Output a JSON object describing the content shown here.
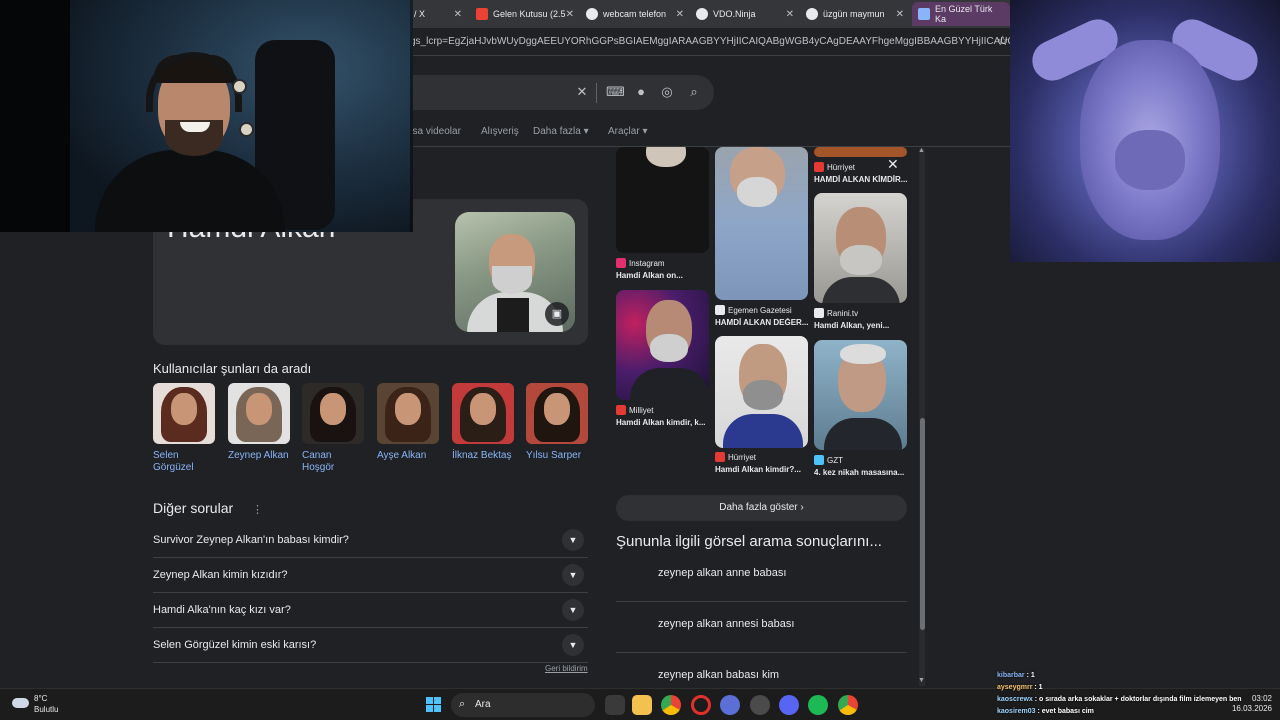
{
  "browser": {
    "tabs": [
      {
        "title": "/ X",
        "icon_color": "#000000"
      },
      {
        "title": "Gelen Kutusu (2.5",
        "icon_color": "#ea4335"
      },
      {
        "title": "webcam telefon",
        "icon_color": "#e8eaed"
      },
      {
        "title": "VDO.Ninja",
        "icon_color": "#e8eaed"
      },
      {
        "title": "üzgün maymun",
        "icon_color": "#e8eaed"
      },
      {
        "title": "En Güzel Türk Ka",
        "icon_color": "#8ab4f8"
      }
    ],
    "address": "gs_lcrp=EgZjaHJvbWUyDggAEEUYORhGGPsBGIAEMggIARAAGBYYHjIICAIQABgWGB4yCAgDEAAYFhgeMggIBBAAGBYYHjIICAUQABgWGB4...",
    "star_icon": "star-icon"
  },
  "search": {
    "query": "",
    "filters": [
      "usa videolar",
      "Alışveriş",
      "Daha fazla",
      "Araçlar"
    ]
  },
  "knowledge_panel": {
    "title": "Hamdi Alkan"
  },
  "people_also_search": {
    "title": "Kullanıcılar şunları da aradı",
    "people": [
      {
        "name": "Selen Görgüzel",
        "hair": "#5a2b1e",
        "bg": "#e6dcd8"
      },
      {
        "name": "Zeynep Alkan",
        "hair": "#7a6656",
        "bg": "#e2e2e2"
      },
      {
        "name": "Canan Hoşgör",
        "hair": "#1a1210",
        "bg": "#2d2a28"
      },
      {
        "name": "Ayşe Alkan",
        "hair": "#3b2417",
        "bg": "#5a4434"
      },
      {
        "name": "İlknaz Bektaş",
        "hair": "#2b1e16",
        "bg": "#c23a3a"
      },
      {
        "name": "Yılsu Sarper",
        "hair": "#20160f",
        "bg": "#b2493c"
      }
    ]
  },
  "other_questions": {
    "title": "Diğer sorular",
    "items": [
      "Survivor Zeynep Alkan'ın babası kimdir?",
      "Zeynep Alkan kimin kızıdır?",
      "Hamdi Alka'nın kaç kızı var?",
      "Selen Görgüzel kimin eski karısı?"
    ],
    "feedback": "Geri bildirim"
  },
  "images": {
    "items": [
      {
        "source": "Instagram",
        "caption": "Hamdi Alkan on...",
        "src_color": "#e1306c"
      },
      {
        "source": "Hürriyet",
        "caption": "HAMDİ ALKAN KİMDİR...",
        "src_color": "#e53935"
      },
      {
        "source": "Ranini.tv",
        "caption": "Hamdi Alkan, yeni...",
        "src_color": "#e8eaed"
      },
      {
        "source": "Egemen Gazetesi",
        "caption": "HAMDİ ALKAN DEĞER...",
        "src_color": "#e8eaed"
      },
      {
        "source": "Milliyet",
        "caption": "Hamdi Alkan kimdir, k...",
        "src_color": "#e53935"
      },
      {
        "source": "Hürriyet",
        "caption": "Hamdi Alkan kimdir?...",
        "src_color": "#e53935"
      },
      {
        "source": "GZT",
        "caption": "4. kez nikah masasına...",
        "src_color": "#4fc3f7"
      }
    ],
    "show_more": "Daha fazla göster",
    "related_title": "Şununla ilgili görsel arama sonuçlarını...",
    "related": [
      "zeynep alkan anne babası",
      "zeynep alkan annesi babası",
      "zeynep alkan babası kim"
    ]
  },
  "taskbar": {
    "weather_temp": "8°C",
    "weather_desc": "Bulutlu",
    "search_label": "Ara",
    "time": "03:02",
    "date": "16.03.2026"
  },
  "chat": [
    {
      "user": "kibarbar",
      "text": "1"
    },
    {
      "user": "ayseygmrr",
      "text": "1"
    },
    {
      "user": "kaoscrewx",
      "text": "o sırada arka sokaklar + doktorlar dışında film izlemeyen ben"
    },
    {
      "user": "kaosirem03",
      "text": "evet babası cim"
    }
  ]
}
